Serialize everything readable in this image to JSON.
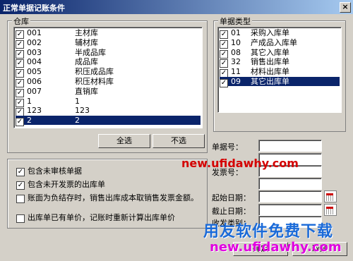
{
  "window": {
    "title": "正常单据记账条件",
    "close_label": "×"
  },
  "warehouse": {
    "label": "仓库",
    "items": [
      {
        "code": "001",
        "name": "主材库",
        "checked": true
      },
      {
        "code": "002",
        "name": "辅材库",
        "checked": true
      },
      {
        "code": "003",
        "name": "半成品库",
        "checked": true
      },
      {
        "code": "004",
        "name": "成品库",
        "checked": true
      },
      {
        "code": "005",
        "name": "积压成品库",
        "checked": true
      },
      {
        "code": "006",
        "name": "积压材料库",
        "checked": true
      },
      {
        "code": "007",
        "name": "直销库",
        "checked": true
      },
      {
        "code": "1",
        "name": "1",
        "checked": true
      },
      {
        "code": "123",
        "name": "123",
        "checked": true
      },
      {
        "code": "2",
        "name": "2",
        "checked": true,
        "selected": true
      }
    ],
    "select_all": "全选",
    "deselect_all": "不选"
  },
  "doc_type": {
    "label": "单据类型",
    "items": [
      {
        "code": "01",
        "name": "采购入库单",
        "checked": true
      },
      {
        "code": "10",
        "name": "产成品入库单",
        "checked": true
      },
      {
        "code": "08",
        "name": "其它入库单",
        "checked": true
      },
      {
        "code": "32",
        "name": "销售出库单",
        "checked": true
      },
      {
        "code": "11",
        "name": "材料出库单",
        "checked": true
      },
      {
        "code": "09",
        "name": "其它出库单",
        "checked": true,
        "selected": true
      }
    ]
  },
  "options": [
    {
      "text": "包含未审核单据",
      "checked": true
    },
    {
      "text": "包含未开发票的出库单",
      "checked": true
    },
    {
      "text": "账面为负结存时，销售出库成本取销售发票金额。",
      "checked": false
    },
    {
      "text": "出库单已有单价，记账时重新计算出库单价",
      "checked": false
    }
  ],
  "fields": {
    "doc_no": "单据号：",
    "invoice_no": "发票号：",
    "start_date": "起始日期：",
    "end_date": "截止日期：",
    "dispatch_type": "收发类别："
  },
  "buttons": {
    "ok": "确定",
    "cancel": "取消"
  },
  "watermark": {
    "top": "new.ufidawhy.com",
    "brand": "用友软件免费下载",
    "bottom": "new.ufidawhy.com"
  }
}
